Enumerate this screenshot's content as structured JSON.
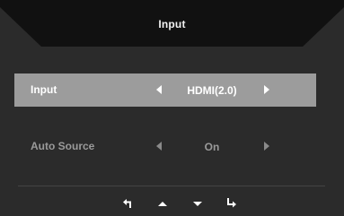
{
  "menu": {
    "title": "Input",
    "items": [
      {
        "label": "Input",
        "value": "HDMI(2.0)",
        "selected": true
      },
      {
        "label": "Auto Source",
        "value": "On",
        "selected": false
      }
    ]
  },
  "colors": {
    "background": "#2b2b2b",
    "banner": "#111111",
    "selected_row": "#9c9c9c",
    "text": "#ffffff",
    "dim_text": "#9a9a9a"
  },
  "nav_icons": [
    "back-icon",
    "up-arrow-icon",
    "down-arrow-icon",
    "enter-icon"
  ]
}
